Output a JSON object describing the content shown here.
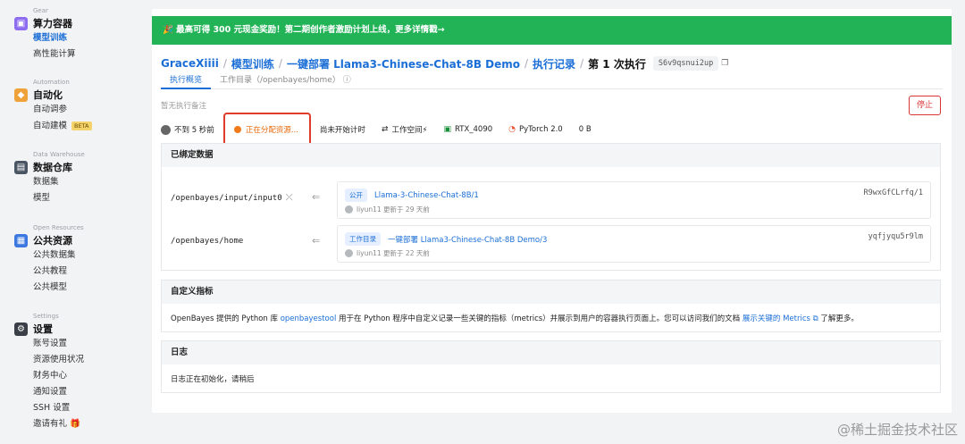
{
  "sidebar": {
    "sections": [
      {
        "en": "Gear",
        "title": "算力容器",
        "items": [
          {
            "label": "模型训练",
            "active": true
          },
          {
            "label": "高性能计算"
          }
        ]
      },
      {
        "en": "Automation",
        "title": "自动化",
        "items": [
          {
            "label": "自动调参"
          },
          {
            "label": "自动建模",
            "badge": "BETA"
          }
        ]
      },
      {
        "en": "Data Warehouse",
        "title": "数据仓库",
        "items": [
          {
            "label": "数据集"
          },
          {
            "label": "模型"
          }
        ]
      },
      {
        "en": "Open Resources",
        "title": "公共资源",
        "items": [
          {
            "label": "公共数据集"
          },
          {
            "label": "公共教程"
          },
          {
            "label": "公共模型"
          }
        ]
      },
      {
        "en": "Settings",
        "title": "设置",
        "items": [
          {
            "label": "账号设置"
          },
          {
            "label": "资源使用状况"
          },
          {
            "label": "财务中心"
          },
          {
            "label": "通知设置"
          },
          {
            "label": "SSH 设置"
          },
          {
            "label": "邀请有礼"
          }
        ]
      }
    ]
  },
  "banner": {
    "text": "🎉 最高可得 300 元现金奖励！第二期创作者激励计划上线，更多详情戳→"
  },
  "breadcrumb": {
    "user": "GraceXiiii",
    "section": "模型训练",
    "project": "一键部署 Llama3-Chinese-Chat-8B Demo",
    "records": "执行记录",
    "current": "第 1 次执行",
    "run_id": "S6v9qsnui2up"
  },
  "tabs": [
    {
      "label": "执行概览",
      "active": true
    },
    {
      "label": "工作目录（/openbayes/home）"
    }
  ],
  "note": "暂无执行备注",
  "stop_button": "停止",
  "stats": {
    "time": "不到 5 秒前",
    "status": "正在分配资源...",
    "timer": "尚未开始计时",
    "workspace": "工作空间⚡",
    "gpu": "RTX_4090",
    "framework": "PyTorch 2.0",
    "storage": "0 B"
  },
  "bound_data": {
    "title": "已绑定数据",
    "rows": [
      {
        "path": "/openbayes/input/input0",
        "badge": "公开",
        "name": "Llama-3-Chinese-Chat-8B/1",
        "hash": "R9wxGfCLrfq/1",
        "user": "liyun11",
        "updated": "更新于 29 天前"
      },
      {
        "path": "/openbayes/home",
        "badge": "工作目录",
        "name": "一键部署 Llama3-Chinese-Chat-8B Demo/3",
        "hash": "yqfjyqu5r9lm",
        "user": "liyun11",
        "updated": "更新于 22 天前"
      }
    ]
  },
  "metrics": {
    "title": "自定义指标",
    "text_before": "OpenBayes 提供的 Python 库 ",
    "link1": "openbayestool",
    "text_middle": " 用于在 Python 程序中自定义记录一些关键的指标（metrics）并展示到用户的容器执行页面上。您可以访问我们的文档 ",
    "link2": "展示关键的 Metrics",
    "text_after": " 了解更多。"
  },
  "logs": {
    "title": "日志",
    "text": "日志正在初始化，请稍后"
  },
  "watermark": "@稀土掘金技术社区",
  "colors": {
    "accent": "#1b6ed6",
    "banner": "#22b357",
    "stop": "#d93636",
    "alloc": "#e86a0c",
    "highlight": "#e23a2a"
  }
}
